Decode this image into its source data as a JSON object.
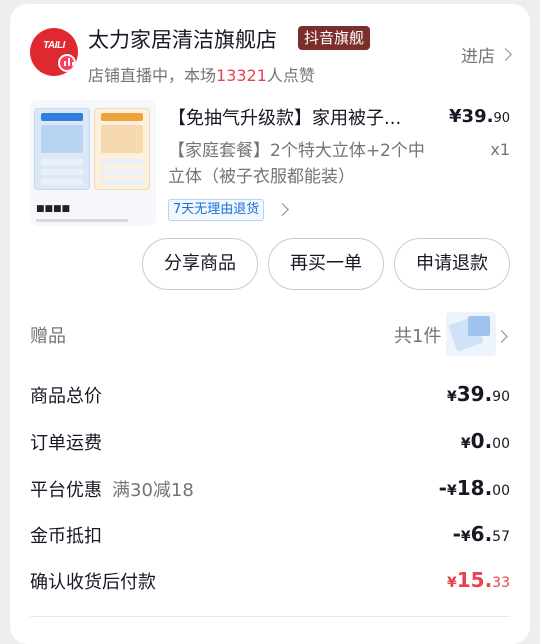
{
  "store": {
    "name": "太力家居清洁旗舰店",
    "badge": "抖音旗舰",
    "live_prefix": "店铺直播中，本场",
    "live_count": "13321",
    "live_suffix": "人点赞",
    "enter": "进店",
    "logo_text": "TAILI"
  },
  "product": {
    "title": "【免抽气升级款】家用被子...",
    "price_int": "¥39.",
    "price_dec": "90",
    "spec": "【家庭套餐】2个特大立体+2个中立体（被子衣服都能装）",
    "qty": "x1",
    "return_tag": "7天无理由退货"
  },
  "actions": {
    "share": "分享商品",
    "rebuy": "再买一单",
    "refund": "申请退款"
  },
  "gift": {
    "label": "赠品",
    "count": "共1件"
  },
  "summary": [
    {
      "label": "商品总价",
      "note": "",
      "sign": "",
      "cur": "¥",
      "int": "39.",
      "dec": "90",
      "red": false
    },
    {
      "label": "订单运费",
      "note": "",
      "sign": "",
      "cur": "¥",
      "int": "0.",
      "dec": "00",
      "red": false
    },
    {
      "label": "平台优惠",
      "note": "满30减18",
      "sign": "-",
      "cur": "¥",
      "int": "18.",
      "dec": "00",
      "red": false
    },
    {
      "label": "金币抵扣",
      "note": "",
      "sign": "-",
      "cur": "¥",
      "int": "6.",
      "dec": "57",
      "red": false
    },
    {
      "label": "确认收货后付款",
      "note": "",
      "sign": "",
      "cur": "¥",
      "int": "15.",
      "dec": "33",
      "red": true
    }
  ],
  "colors": {
    "accent_red": "#e8424d",
    "badge_bg": "#7a2f2c",
    "link_blue": "#1a6fd6"
  }
}
